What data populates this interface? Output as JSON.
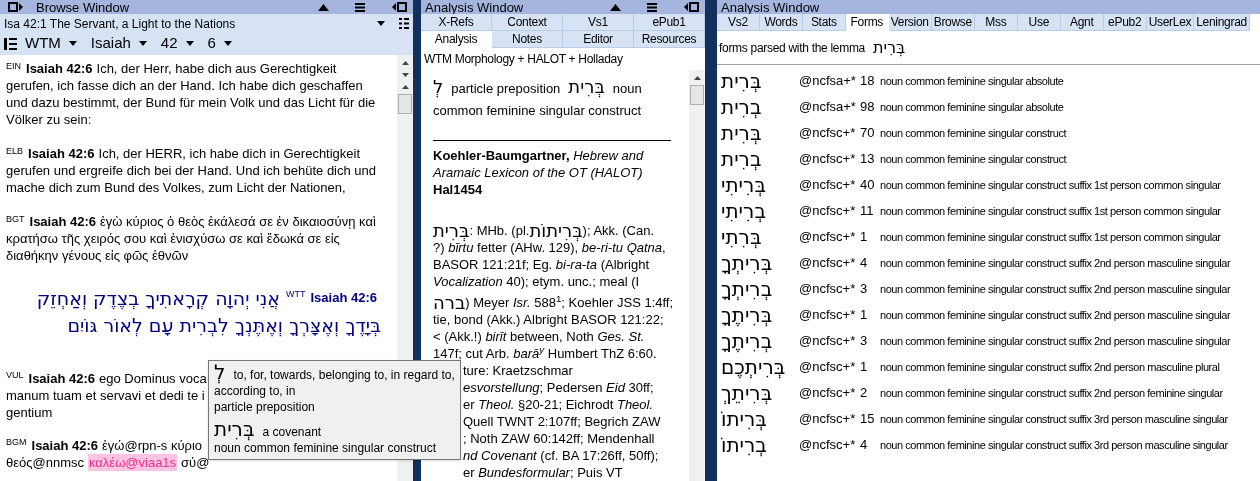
{
  "browse_window": {
    "title": "Browse Window",
    "passage": "Isa 42:1 The Servant, a Light to the Nations",
    "selectors": [
      "WTM",
      "Isaiah",
      "42",
      "6"
    ],
    "verses": [
      {
        "kind": "text",
        "version": "EIN",
        "ref": "Isaiah 42:6",
        "text": "Ich, der Herr, habe dich aus Gerechtigkeit gerufen, ich fasse dich an der Hand. Ich habe dich geschaffen und dazu bestimmt, der Bund für mein Volk und das Licht für die Völker zu sein:"
      },
      {
        "kind": "text",
        "version": "ELB",
        "ref": "Isaiah 42:6",
        "text": "Ich, der HERR, ich habe dich in Gerechtigkeit gerufen und ergreife dich bei der Hand. Und ich behüte dich und mache dich zum Bund des Volkes, zum Licht der Nationen,"
      },
      {
        "kind": "text",
        "version": "BGT",
        "ref": "Isaiah 42:6",
        "text": "ἐγὼ κύριος ὁ θεὸς ἐκάλεσά σε ἐν δικαιοσύνῃ καὶ κρατήσω τῆς χειρός σου καὶ ἐνισχύσω σε καὶ ἔδωκά σε εἰς διαθήκην γένους εἰς φῶς ἐθνῶν"
      },
      {
        "kind": "hebrew",
        "version": "WTT",
        "ref": "Isaiah 42:6",
        "lines": [
          "אֲנִי יְהוָה קְרָאתִיךָ בְצֶדֶק וְאַחְזֵק",
          "בְּיָדֶךָ וְאֶצָּרְךָ וְאֶתֶּנְךָ לִבְרִית עָם לְאוֹר גּוֹיִם"
        ]
      },
      {
        "kind": "cut",
        "version": "VUL",
        "ref": "Isaiah 42:6",
        "lines": [
          [
            {
              "text": "ego Dominus voca",
              "highlight": false
            }
          ],
          [
            {
              "text": "manum tuam et servavi et dedi te i",
              "highlight": false
            }
          ],
          [
            {
              "text": "gentium",
              "highlight": false
            }
          ]
        ]
      },
      {
        "kind": "cut",
        "version": "BGM",
        "ref": "Isaiah 42:6",
        "lines": [
          [
            {
              "text": "ἐγώ@rpn-s κύριο",
              "highlight": false
            }
          ],
          [
            {
              "text": "θεός@nnmsc",
              "highlight": false
            },
            {
              "text": "καλέω@viaa1s",
              "highlight": true
            },
            {
              "text": "σύ@",
              "highlight": false
            }
          ]
        ]
      }
    ]
  },
  "tooltip": {
    "entries": [
      {
        "word": "לְ",
        "gloss": "to, for, towards, belonging to, in regard to, according to, in",
        "parsing": "particle preposition"
      },
      {
        "word": "בְּרִית",
        "gloss": "a covenant",
        "parsing": "noun common feminine singular construct"
      }
    ]
  },
  "analysis_window": {
    "title": "Analysis Window",
    "tab_rows": [
      [
        {
          "label": "X-Refs",
          "selected": false
        },
        {
          "label": "Context",
          "selected": false
        },
        {
          "label": "Vs1",
          "selected": false
        },
        {
          "label": "ePub1",
          "selected": false
        }
      ],
      [
        {
          "label": "Analysis",
          "selected": true
        },
        {
          "label": "Notes",
          "selected": false
        },
        {
          "label": "Editor",
          "selected": false
        },
        {
          "label": "Resources",
          "selected": false
        }
      ]
    ],
    "source": "WTM Morphology + HALOT + Holladay",
    "morphology_line": [
      {
        "kind": "hebrew",
        "text": "לְ"
      },
      {
        "kind": "text",
        "text": "particle preposition"
      },
      {
        "kind": "hebrew",
        "text": "בְּרִית"
      },
      {
        "kind": "text",
        "text": "noun common feminine singular construct"
      }
    ],
    "lexicon_title": "**Koehler-Baumgartner,** *Hebrew and Aramaic Lexicon of the OT (HALOT)*",
    "lexicon_id": "Hal1454",
    "entry_lines": [
      [
        {
          "kind": "hebrew",
          "text": "בְּרִית"
        },
        {
          "kind": "text",
          "text": ": MHb. (pl. "
        },
        {
          "kind": "hebrew",
          "text": "בְּרִיתוֹת"
        },
        {
          "kind": "text",
          "text": "); Akk. (Can."
        }
      ],
      [
        {
          "kind": "text",
          "text": "?) *bīrtu* fetter (AHw. 129), *be-ri-tu Qatna*,"
        }
      ],
      [
        {
          "kind": "text",
          "text": "BASOR 121:21f; Eg. *bi-ra-ta* (Albright"
        }
      ],
      [
        {
          "kind": "text",
          "text": "*Vocalization* 40); etym. unc.; meal (I"
        }
      ],
      [
        {
          "kind": "hebrew",
          "text": "ברה"
        },
        {
          "kind": "text",
          "text": ") Meyer *Isr.* 588$^{1}$; Koehler JSS 1:4ff;"
        }
      ],
      [
        {
          "kind": "text",
          "text": "tie, bond (Akk.) Albright BASOR 121:22;"
        }
      ],
      [
        {
          "kind": "text",
          "text": "< (Akk.!) *birīt* between, Noth *Ges. St.*"
        }
      ],
      [
        {
          "kind": "text",
          "text": "147f; cut Arb. *barā$^{y}$* Humbert ThZ 6:60."
        }
      ]
    ],
    "covered_lines": [
      "ture: Kraetzschmar",
      "*esvorstellung*; Pedersen *Eid* 30ff;",
      "er *Theol.* §20-21; Eichrodt *Theol.*",
      "Quell TWNT 2:107ff; Begrich ZAW",
      "; Noth ZAW 60:142ff; Mendenhall",
      "*nd Covenant* (cf. BA 17:26ff, 50ff);",
      "er *Bundesformular*; Puis VT"
    ]
  },
  "forms_window": {
    "title": "Analysis Window",
    "tabs": [
      {
        "label": "Vs2",
        "selected": false
      },
      {
        "label": "Words",
        "selected": false
      },
      {
        "label": "Stats",
        "selected": false
      },
      {
        "label": "Forms",
        "selected": true
      },
      {
        "label": "Version",
        "selected": false
      },
      {
        "label": "Browse",
        "selected": false
      },
      {
        "label": "Mss",
        "selected": false
      },
      {
        "label": "Use",
        "selected": false
      },
      {
        "label": "Agnt",
        "selected": false
      },
      {
        "label": "ePub2",
        "selected": false
      },
      {
        "label": "UserLex",
        "selected": false
      },
      {
        "label": "Leningrad",
        "selected": false
      }
    ],
    "lemma_label": "forms parsed with the lemma",
    "lemma": "בְּרִית",
    "forms": [
      {
        "form": "בְּרִית",
        "code": "@ncfsa+*",
        "count": "18",
        "parsing": "noun common feminine singular absolute"
      },
      {
        "form": "בְרִית",
        "code": "@ncfsa+*",
        "count": "98",
        "parsing": "noun common feminine singular absolute"
      },
      {
        "form": "בְּרִית",
        "code": "@ncfsc+*",
        "count": "70",
        "parsing": "noun common feminine singular construct"
      },
      {
        "form": "בְרִית",
        "code": "@ncfsc+*",
        "count": "13",
        "parsing": "noun common feminine singular construct"
      },
      {
        "form": "בְּרִיתִי",
        "code": "@ncfsc+*",
        "count": "40",
        "parsing": "noun common feminine singular construct suffix 1st person common singular"
      },
      {
        "form": "בְרִיתִי",
        "code": "@ncfsc+*",
        "count": "11",
        "parsing": "noun common feminine singular construct suffix 1st person common singular"
      },
      {
        "form": "בְּרִתִי",
        "code": "@ncfsc+*",
        "count": "1",
        "parsing": "noun common feminine singular construct suffix 1st person common singular"
      },
      {
        "form": "בְּרִיתְךָ",
        "code": "@ncfsc+*",
        "count": "4",
        "parsing": "noun common feminine singular construct suffix 2nd person masculine singular"
      },
      {
        "form": "בְרִיתְךָ",
        "code": "@ncfsc+*",
        "count": "3",
        "parsing": "noun common feminine singular construct suffix 2nd person masculine singular"
      },
      {
        "form": "בְּרִיתֶךָ",
        "code": "@ncfsc+*",
        "count": "1",
        "parsing": "noun common feminine singular construct suffix 2nd person masculine singular"
      },
      {
        "form": "בְרִיתֶךָ",
        "code": "@ncfsc+*",
        "count": "3",
        "parsing": "noun common feminine singular construct suffix 2nd person masculine singular"
      },
      {
        "form": "בְּרִיתְכֶם",
        "code": "@ncfsc+*",
        "count": "1",
        "parsing": "noun common feminine singular construct suffix 2nd person masculine plural"
      },
      {
        "form": "בְּרִיתֵךְ",
        "code": "@ncfsc+*",
        "count": "2",
        "parsing": "noun common feminine singular construct suffix 2nd person feminine singular"
      },
      {
        "form": "בְּרִיתוֹ",
        "code": "@ncfsc+*",
        "count": "15",
        "parsing": "noun common feminine singular construct suffix 3rd person masculine singular"
      },
      {
        "form": "בְרִיתוֹ",
        "code": "@ncfsc+*",
        "count": "4",
        "parsing": "noun common feminine singular construct suffix 3rd person masculine singular"
      }
    ]
  }
}
